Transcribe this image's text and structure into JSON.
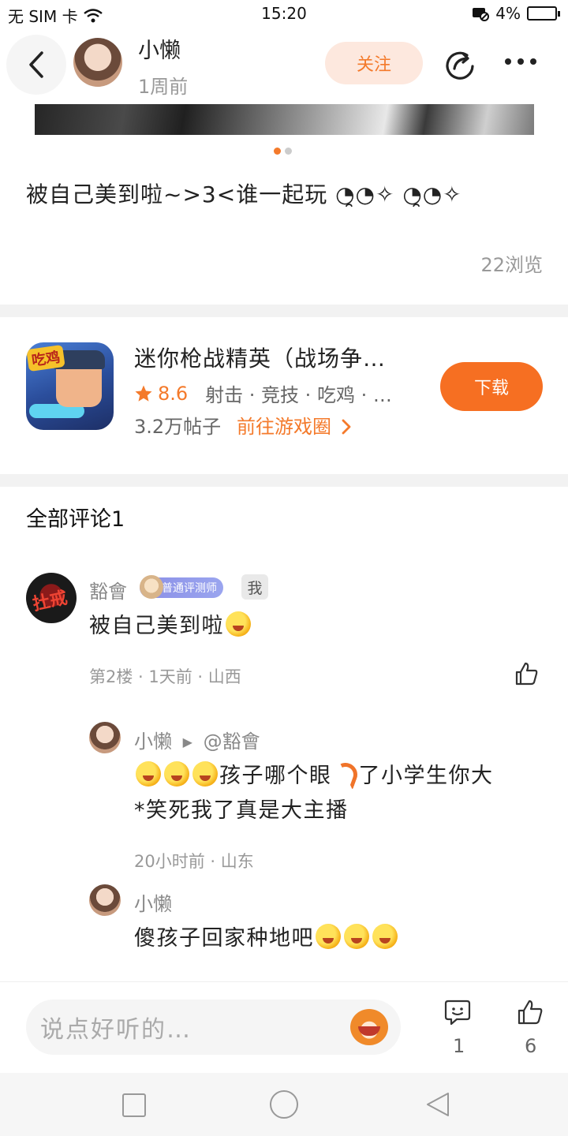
{
  "status_bar": {
    "carrier": "无 SIM 卡",
    "time": "15:20",
    "battery": "4%"
  },
  "header": {
    "author_name": "小懒",
    "post_time": "1周前",
    "follow_label": "关注"
  },
  "carousel": {
    "page_count": 2,
    "active_index": 0
  },
  "post": {
    "text": "被自己美到啦~>3<谁一起玩 ◔̯◔✧ ◔̯◔✧",
    "views": "22浏览"
  },
  "game": {
    "title": "迷你枪战精英（战场争…",
    "icon_badge": "吃鸡",
    "rating": "8.6",
    "tags": "射击 · 竞技 · 吃鸡 · …",
    "posts": "3.2万帖子",
    "link": "前往游戏圈",
    "download_label": "下载"
  },
  "comments_title": "全部评论1",
  "comments": {
    "main": {
      "name": "豁會",
      "avatar_text": "扗戒",
      "rank_badge": "普通评测师",
      "me_badge": "我",
      "text": "被自己美到啦",
      "meta": "第2楼 · 1天前 · 山西"
    },
    "reply1": {
      "name": "小懒",
      "arrow": "▶",
      "target": "@豁會",
      "text_part1": "孩子哪个眼",
      "text_part2": "了小学生你大",
      "text_line2": "*笑死我了真是大主播",
      "meta": "20小时前 · 山东"
    },
    "reply2": {
      "name": "小懒",
      "text": "傻孩子回家种地吧"
    }
  },
  "bottom_bar": {
    "input_placeholder": "说点好听的…",
    "comment_count": "1",
    "like_count": "6"
  },
  "colors": {
    "accent": "#f66f22",
    "follow_bg": "#fde8de",
    "divider": "#f2f2f2"
  },
  "icons": [
    "back-icon",
    "share-icon",
    "more-icon",
    "star-icon",
    "chevron-right-icon",
    "like-icon",
    "comment-icon",
    "monkey-emoji-icon",
    "nav-recent-icon",
    "nav-home-icon",
    "nav-back-icon"
  ]
}
